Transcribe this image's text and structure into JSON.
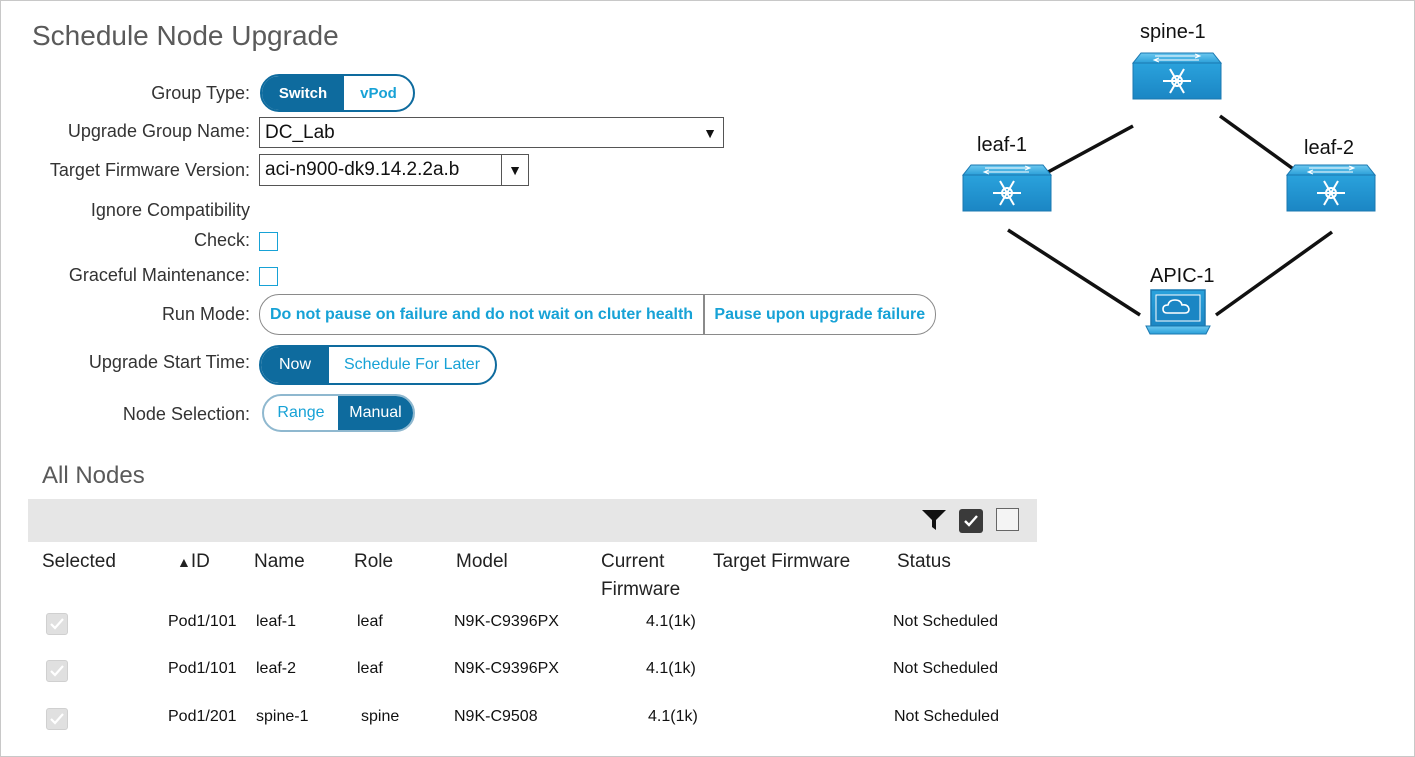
{
  "page": {
    "title": "Schedule Node Upgrade"
  },
  "form": {
    "group_type": {
      "label": "Group Type:",
      "options": [
        "Switch",
        "vPod"
      ],
      "selected": "Switch"
    },
    "upgrade_group_name": {
      "label": "Upgrade Group Name:",
      "value": "DC_Lab"
    },
    "target_firmware": {
      "label": "Target Firmware Version:",
      "value": "aci-n900-dk9.14.2.2a.b"
    },
    "ignore_compat": {
      "label_line1": "Ignore Compatibility",
      "label_line2": "Check:",
      "checked": false
    },
    "graceful": {
      "label": "Graceful Maintenance:",
      "checked": false
    },
    "run_mode": {
      "label": "Run Mode:",
      "options": [
        "Do not pause on failure and do not wait on cluter health",
        "Pause upon upgrade failure"
      ]
    },
    "start_time": {
      "label": "Upgrade Start Time:",
      "options": [
        "Now",
        "Schedule For Later"
      ],
      "selected": "Now"
    },
    "node_selection": {
      "label": "Node Selection:",
      "options": [
        "Range",
        "Manual"
      ],
      "selected": "Manual"
    }
  },
  "table": {
    "title": "All Nodes",
    "toolbar_icons": [
      "filter-icon",
      "check-all-icon",
      "uncheck-all-icon"
    ],
    "columns": [
      "Selected",
      "ID",
      "Name",
      "Role",
      "Model",
      "Current",
      "Firmware",
      "Target Firmware",
      "Status"
    ],
    "sort_indicator": "▲",
    "rows": [
      {
        "id": "Pod1/101",
        "name": "leaf-1",
        "role": "leaf",
        "model": "N9K-C9396PX",
        "current": "4.1(1k)",
        "target": "",
        "status": "Not Scheduled"
      },
      {
        "id": "Pod1/101",
        "name": "leaf-2",
        "role": "leaf",
        "model": "N9K-C9396PX",
        "current": "4.1(1k)",
        "target": "",
        "status": "Not Scheduled"
      },
      {
        "id": "Pod1/201",
        "name": "spine-1",
        "role": "spine",
        "model": "N9K-C9508",
        "current": "4.1(1k)",
        "target": "",
        "status": "Not Scheduled"
      }
    ]
  },
  "topology": {
    "nodes": [
      "spine-1",
      "leaf-1",
      "leaf-2",
      "APIC-1"
    ]
  },
  "colors": {
    "accent": "#0e6b9e",
    "accent_light": "#17a2d6",
    "device": "#2a9fd8"
  }
}
